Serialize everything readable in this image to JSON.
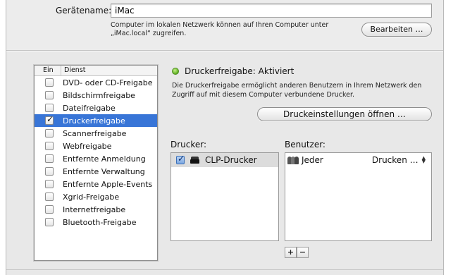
{
  "device": {
    "name_label": "Gerätename:",
    "name_value": "iMac",
    "description_line1": "Computer im lokalen Netzwerk können auf Ihren Computer unter",
    "description_line2": "„iMac.local“ zugreifen.",
    "edit_button": "Bearbeiten …"
  },
  "services": {
    "header_on": "Ein",
    "header_service": "Dienst",
    "items": [
      {
        "label": "DVD- oder CD-Freigabe",
        "checked": false,
        "selected": false
      },
      {
        "label": "Bildschirmfreigabe",
        "checked": false,
        "selected": false
      },
      {
        "label": "Dateifreigabe",
        "checked": false,
        "selected": false
      },
      {
        "label": "Druckerfreigabe",
        "checked": true,
        "selected": true
      },
      {
        "label": "Scannerfreigabe",
        "checked": false,
        "selected": false
      },
      {
        "label": "Webfreigabe",
        "checked": false,
        "selected": false
      },
      {
        "label": "Entfernte Anmeldung",
        "checked": false,
        "selected": false
      },
      {
        "label": "Entfernte Verwaltung",
        "checked": false,
        "selected": false
      },
      {
        "label": "Entfernte Apple-Events",
        "checked": false,
        "selected": false
      },
      {
        "label": "Xgrid-Freigabe",
        "checked": false,
        "selected": false
      },
      {
        "label": "Internetfreigabe",
        "checked": false,
        "selected": false
      },
      {
        "label": "Bluetooth-Freigabe",
        "checked": false,
        "selected": false
      }
    ]
  },
  "detail": {
    "status_title": "Druckerfreigabe: Aktiviert",
    "status_color": "#5fb020",
    "description": "Die Druckerfreigabe ermöglicht anderen Benutzern in Ihrem Netzwerk den Zugriff auf mit diesem Computer verbundene Drucker.",
    "print_settings_button": "Druckeinstellungen öffnen …",
    "printers_label": "Drucker:",
    "users_label": "Benutzer:",
    "printers": [
      {
        "name": "CLP-Drucker",
        "checked": true
      }
    ],
    "users": [
      {
        "name": "Jeder",
        "permission": "Drucken …"
      }
    ],
    "add_button": "+",
    "remove_button": "−"
  },
  "colors": {
    "selection": "#3875d7",
    "window_bg": "#e8e8e8"
  }
}
